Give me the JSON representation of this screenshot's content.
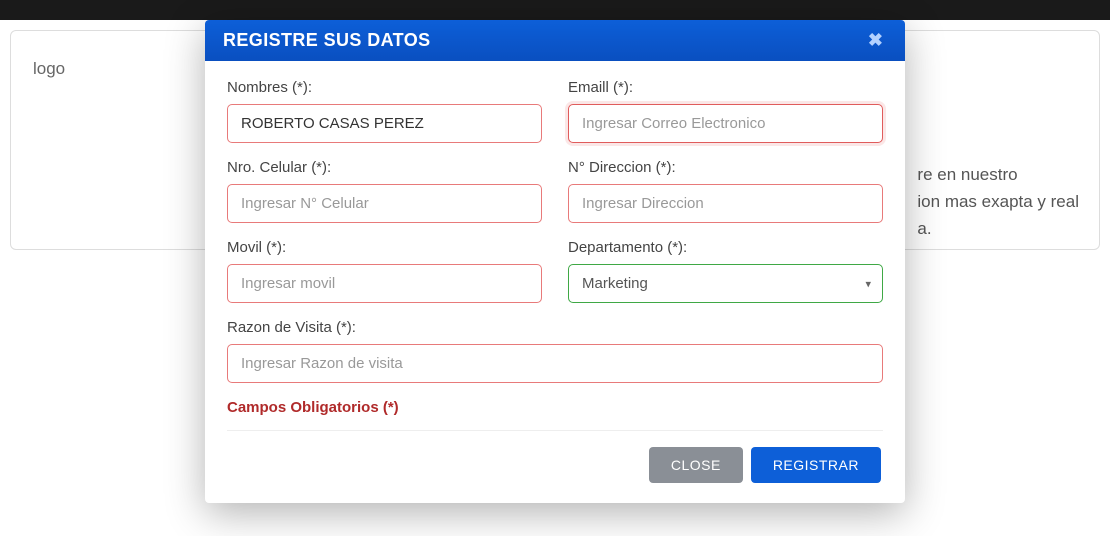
{
  "background": {
    "logo_text": "logo",
    "text_line1": "re en nuestro",
    "text_line2": "ion mas exapta y real",
    "text_line3": "a."
  },
  "modal": {
    "title": "REGISTRE SUS DATOS",
    "close_symbol": "✖",
    "fields": {
      "nombres": {
        "label": "Nombres (*):",
        "value": "ROBERTO CASAS PEREZ",
        "placeholder": ""
      },
      "email": {
        "label": "Emaill (*):",
        "value": "",
        "placeholder": "Ingresar Correo Electronico"
      },
      "celular": {
        "label": "Nro. Celular (*):",
        "value": "",
        "placeholder": "Ingresar N° Celular"
      },
      "direccion": {
        "label": "N° Direccion (*):",
        "value": "",
        "placeholder": "Ingresar Direccion"
      },
      "movil": {
        "label": "Movil (*):",
        "value": "",
        "placeholder": "Ingresar movil"
      },
      "departamento": {
        "label": "Departamento (*):",
        "selected": "Marketing"
      },
      "razon": {
        "label": "Razon de Visita (*):",
        "value": "",
        "placeholder": "Ingresar Razon de visita"
      }
    },
    "required_note": "Campos Obligatorios (*)",
    "buttons": {
      "close": "CLOSE",
      "register": "REGISTRAR"
    }
  }
}
